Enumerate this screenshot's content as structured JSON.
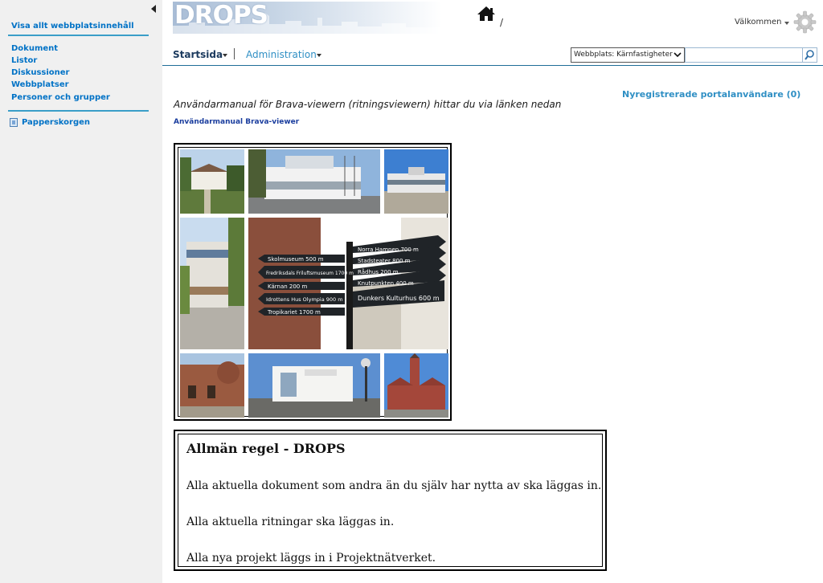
{
  "site": {
    "logo_text": "DROPS",
    "breadcrumb_separator": "/"
  },
  "header": {
    "welcome_label": "Välkommen",
    "icons": [
      "home-icon",
      "gear-icon",
      "search-icon"
    ]
  },
  "leftnav": {
    "view_all": "Visa allt webbplatsinnehåll",
    "items": [
      "Dokument",
      "Listor",
      "Diskussioner",
      "Webbplatser",
      "Personer och grupper"
    ],
    "recycle_bin": "Papperskorgen"
  },
  "topnav": {
    "tabs": [
      {
        "label": "Startsida"
      },
      {
        "label": "Administration"
      }
    ]
  },
  "search": {
    "scope_value": "Webbplats: Kärnfastigheter",
    "query": ""
  },
  "main": {
    "new_users_link": "Nyregistrerade portalanvändare (0)",
    "manual_intro": "Användarmanual för Brava-viewern (ritningsviewern) hittar du via länken nedan",
    "manual_link": "Användarmanual Brava-viewer",
    "photo_collage_signs": [
      "Norra Hamnen 700 m",
      "Stadsteater 800 m",
      "Rådhus 200 m",
      "Knutpunkten 400 m",
      "Dunkers Kulturhus 600 m",
      "Skolmuseum 500 m",
      "Fredriksdals Friluftsmuseum 1700 m",
      "Kärnan 200 m",
      "Idrottens Hus Olympia 900 m",
      "Tropikariet 1700 m"
    ],
    "rule_box": {
      "title": "Allmän regel - DROPS",
      "lines": [
        "Alla aktuella dokument som andra än du själv har nytta av ska läggas in.",
        "Alla aktuella ritningar ska läggas in.",
        "Alla nya projekt läggs in i Projektnätverket."
      ]
    }
  },
  "colors": {
    "link_blue": "#2f8fc4",
    "nav_blue": "#0072c6",
    "dark_link": "#1a3d9e",
    "sidebar_bg": "#f0f0f0"
  }
}
